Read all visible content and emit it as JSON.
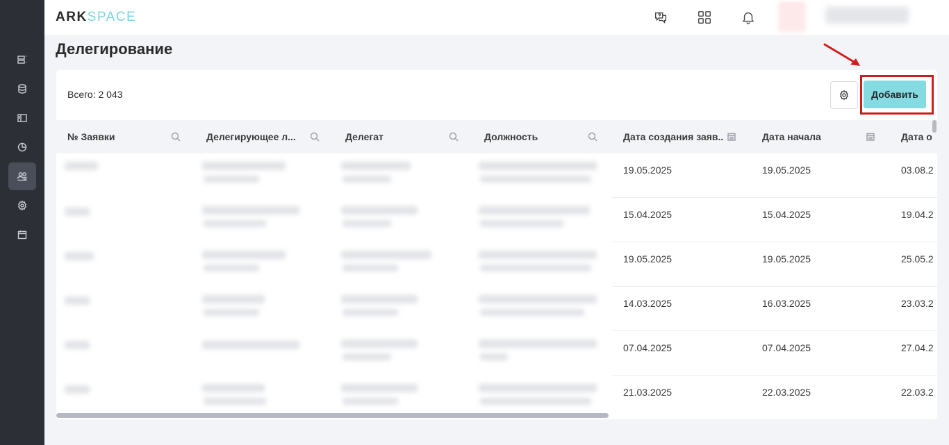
{
  "app": {
    "logo_ark": "ARK",
    "logo_space": "SPACE"
  },
  "sidebar": {
    "items": [
      {
        "icon": "list-icon"
      },
      {
        "icon": "database-icon"
      },
      {
        "icon": "panel-icon"
      },
      {
        "icon": "pie-chart-icon"
      },
      {
        "icon": "users-icon",
        "active": true
      },
      {
        "icon": "gear-icon"
      },
      {
        "icon": "calendar-icon"
      }
    ]
  },
  "header": {
    "icons": [
      "chat-help-icon",
      "apps-grid-icon",
      "bell-icon"
    ]
  },
  "page": {
    "title": "Делегирование",
    "total": "Всего: 2 043",
    "add_label": "Добавить"
  },
  "table": {
    "columns": [
      {
        "label": "№ Заявки",
        "filter": "search-icon"
      },
      {
        "label": "Делегирующее л...",
        "filter": "search-icon"
      },
      {
        "label": "Делегат",
        "filter": "search-icon"
      },
      {
        "label": "Должность",
        "filter": "search-icon"
      },
      {
        "label": "Дата создания заяв...",
        "filter": "calendar-icon"
      },
      {
        "label": "Дата начала",
        "filter": "calendar-icon"
      },
      {
        "label": "Дата о",
        "filter": ""
      }
    ],
    "rows": [
      {
        "created": "19.05.2025",
        "start": "19.05.2025",
        "end": "03.08.2"
      },
      {
        "created": "15.04.2025",
        "start": "15.04.2025",
        "end": "19.04.2"
      },
      {
        "created": "19.05.2025",
        "start": "19.05.2025",
        "end": "25.05.2"
      },
      {
        "created": "14.03.2025",
        "start": "16.03.2025",
        "end": "23.03.2"
      },
      {
        "created": "07.04.2025",
        "start": "07.04.2025",
        "end": "27.04.2"
      },
      {
        "created": "21.03.2025",
        "start": "22.03.2025",
        "end": "22.03.2"
      }
    ]
  },
  "colors": {
    "sidebar_bg": "#2c2f36",
    "accent": "#86dbe3",
    "highlight": "#c81e1e"
  }
}
